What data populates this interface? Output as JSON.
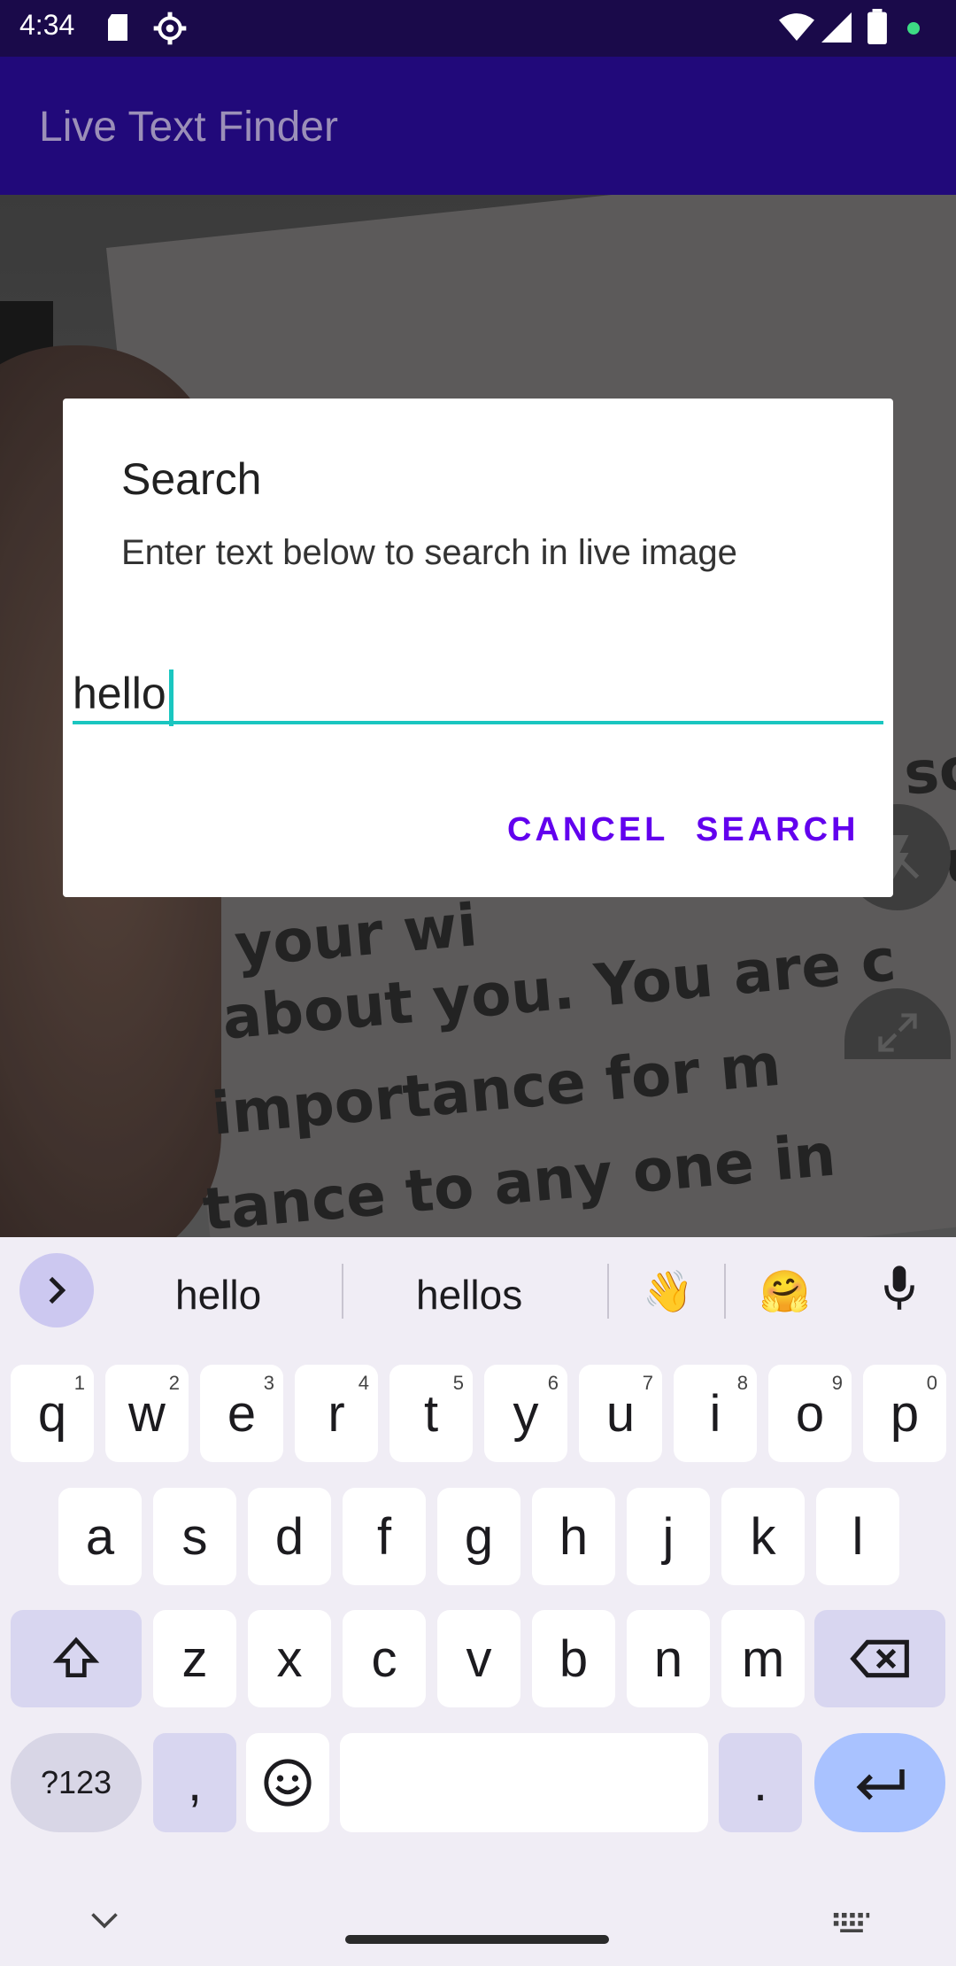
{
  "status_bar": {
    "time": "4:34"
  },
  "app_bar": {
    "title": "Live Text Finder"
  },
  "camera": {
    "lines": [
      "your wi",
      "about you. You are c",
      "importance for m",
      "tance to any one in"
    ],
    "fragments": [
      "so",
      "ou"
    ]
  },
  "dialog": {
    "title": "Search",
    "message": "Enter text below to search in live image",
    "input_value": "hello",
    "cancel_label": "CANCEL",
    "search_label": "SEARCH"
  },
  "keyboard": {
    "suggestions": [
      "hello",
      "hellos",
      "👋",
      "🤗"
    ],
    "row1": [
      {
        "k": "q",
        "h": "1"
      },
      {
        "k": "w",
        "h": "2"
      },
      {
        "k": "e",
        "h": "3"
      },
      {
        "k": "r",
        "h": "4"
      },
      {
        "k": "t",
        "h": "5"
      },
      {
        "k": "y",
        "h": "6"
      },
      {
        "k": "u",
        "h": "7"
      },
      {
        "k": "i",
        "h": "8"
      },
      {
        "k": "o",
        "h": "9"
      },
      {
        "k": "p",
        "h": "0"
      }
    ],
    "row2": [
      "a",
      "s",
      "d",
      "f",
      "g",
      "h",
      "j",
      "k",
      "l"
    ],
    "row3": [
      "z",
      "x",
      "c",
      "v",
      "b",
      "n",
      "m"
    ],
    "symbols_label": "?123",
    "comma": ",",
    "period": "."
  },
  "colors": {
    "accent": "#6200ee",
    "input_underline": "#1ac6c0",
    "app_bar": "#21097a",
    "status_bar": "#1a0a4a"
  }
}
